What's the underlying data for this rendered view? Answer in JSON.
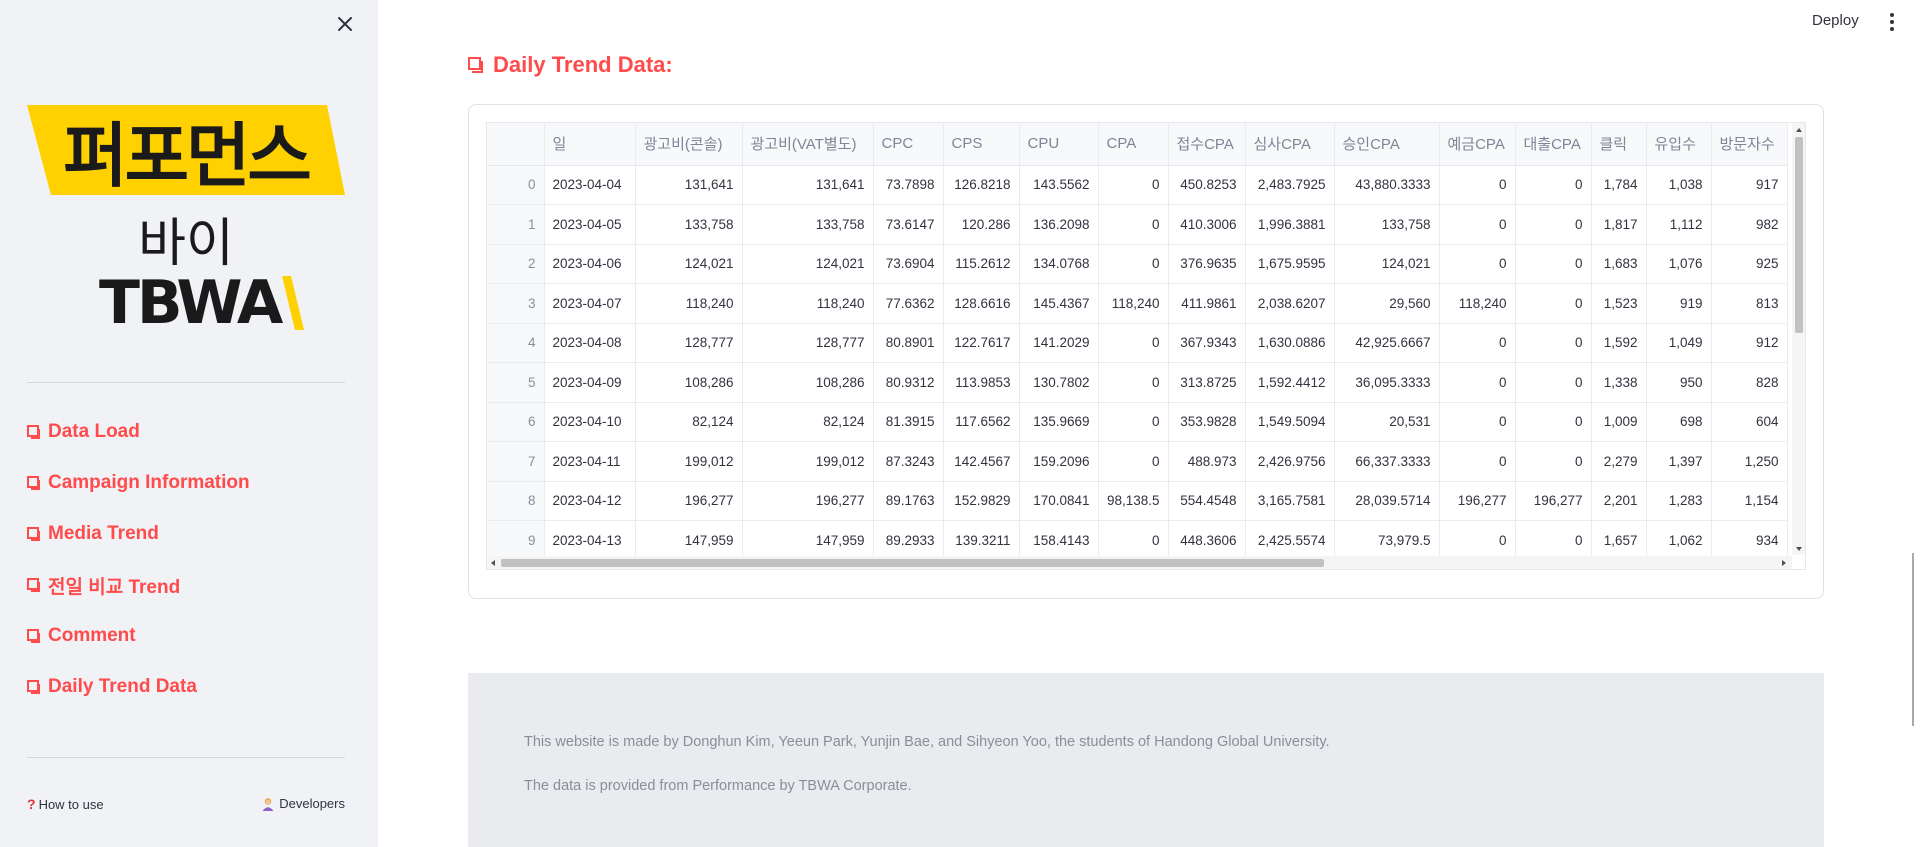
{
  "header": {
    "deploy_label": "Deploy"
  },
  "sidebar": {
    "logo": {
      "band_text": "퍼포먼스",
      "sub_text": "바이",
      "brand_text": "TBWA",
      "accent_color": "#ffd100"
    },
    "nav": [
      {
        "label": "Data Load"
      },
      {
        "label": "Campaign Information"
      },
      {
        "label": "Media Trend"
      },
      {
        "label": "전일 비교 Trend"
      },
      {
        "label": "Comment"
      },
      {
        "label": "Daily Trend Data"
      }
    ],
    "footer": {
      "how_to_use": "How to use",
      "developers": "Developers"
    }
  },
  "main": {
    "section_title": "Daily Trend Data:",
    "accent_color": "#ff4b4b",
    "table": {
      "columns": [
        "",
        "일",
        "광고비(콘솔)",
        "광고비(VAT별도)",
        "CPC",
        "CPS",
        "CPU",
        "CPA",
        "접수CPA",
        "심사CPA",
        "승인CPA",
        "예금CPA",
        "대출CPA",
        "클릭",
        "유입수",
        "방문자수"
      ],
      "rows": [
        [
          "0",
          "2023-04-04",
          "131,641",
          "131,641",
          "73.7898",
          "126.8218",
          "143.5562",
          "0",
          "450.8253",
          "2,483.7925",
          "43,880.3333",
          "0",
          "0",
          "1,784",
          "1,038",
          "917"
        ],
        [
          "1",
          "2023-04-05",
          "133,758",
          "133,758",
          "73.6147",
          "120.286",
          "136.2098",
          "0",
          "410.3006",
          "1,996.3881",
          "133,758",
          "0",
          "0",
          "1,817",
          "1,112",
          "982"
        ],
        [
          "2",
          "2023-04-06",
          "124,021",
          "124,021",
          "73.6904",
          "115.2612",
          "134.0768",
          "0",
          "376.9635",
          "1,675.9595",
          "124,021",
          "0",
          "0",
          "1,683",
          "1,076",
          "925"
        ],
        [
          "3",
          "2023-04-07",
          "118,240",
          "118,240",
          "77.6362",
          "128.6616",
          "145.4367",
          "118,240",
          "411.9861",
          "2,038.6207",
          "29,560",
          "118,240",
          "0",
          "1,523",
          "919",
          "813"
        ],
        [
          "4",
          "2023-04-08",
          "128,777",
          "128,777",
          "80.8901",
          "122.7617",
          "141.2029",
          "0",
          "367.9343",
          "1,630.0886",
          "42,925.6667",
          "0",
          "0",
          "1,592",
          "1,049",
          "912"
        ],
        [
          "5",
          "2023-04-09",
          "108,286",
          "108,286",
          "80.9312",
          "113.9853",
          "130.7802",
          "0",
          "313.8725",
          "1,592.4412",
          "36,095.3333",
          "0",
          "0",
          "1,338",
          "950",
          "828"
        ],
        [
          "6",
          "2023-04-10",
          "82,124",
          "82,124",
          "81.3915",
          "117.6562",
          "135.9669",
          "0",
          "353.9828",
          "1,549.5094",
          "20,531",
          "0",
          "0",
          "1,009",
          "698",
          "604"
        ],
        [
          "7",
          "2023-04-11",
          "199,012",
          "199,012",
          "87.3243",
          "142.4567",
          "159.2096",
          "0",
          "488.973",
          "2,426.9756",
          "66,337.3333",
          "0",
          "0",
          "2,279",
          "1,397",
          "1,250"
        ],
        [
          "8",
          "2023-04-12",
          "196,277",
          "196,277",
          "89.1763",
          "152.9829",
          "170.0841",
          "98,138.5",
          "554.4548",
          "3,165.7581",
          "28,039.5714",
          "196,277",
          "196,277",
          "2,201",
          "1,283",
          "1,154"
        ],
        [
          "9",
          "2023-04-13",
          "147,959",
          "147,959",
          "89.2933",
          "139.3211",
          "158.4143",
          "0",
          "448.3606",
          "2,425.5574",
          "73,979.5",
          "0",
          "0",
          "1,657",
          "1,062",
          "934"
        ]
      ]
    },
    "footer": {
      "line1": "This website is made by Donghun Kim, Yeeun Park, Yunjin Bae, and Sihyeon Yoo, the students of Handong Global University.",
      "line2": "The data is provided from Performance by TBWA Corporate."
    }
  }
}
